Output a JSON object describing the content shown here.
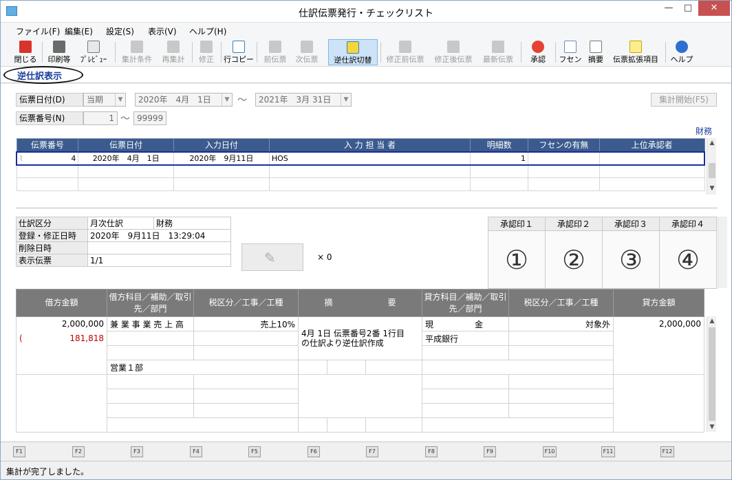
{
  "window": {
    "title": "仕訳伝票発行・チェックリスト",
    "minimize": "—",
    "maximize": "□",
    "close": "✕"
  },
  "menu": [
    "ファイル(F)",
    "編集(E)",
    "設定(S)",
    "表示(V)",
    "ヘルプ(H)"
  ],
  "toolbar": {
    "close": "閉じる",
    "print": "印刷等",
    "preview": "ﾌﾟﾚﾋﾞｭｰ",
    "agg_cond": "集計条件",
    "reagg": "再集計",
    "edit": "修正",
    "row_copy": "行コピー",
    "prev_slip": "前伝票",
    "next_slip": "次伝票",
    "reverse_switch": "逆仕訳切替",
    "before_edit": "修正前伝票",
    "after_edit": "修正後伝票",
    "latest": "最新伝票",
    "approve": "承認",
    "fusen": "フセン",
    "summary": "摘要",
    "ext_items": "伝票拡張項目",
    "help": "ヘルプ"
  },
  "tab": {
    "label": "逆仕訳表示"
  },
  "filters": {
    "date_label": "伝票日付(D)",
    "period": "当期",
    "date_from": "2020年　4月　1日",
    "date_to": "2021年　3月 31日",
    "number_label": "伝票番号(N)",
    "num_from": "1",
    "num_to": "99999",
    "tilde": "～",
    "start_button": "集計開始(F5)"
  },
  "dept_link": "財務",
  "list": {
    "headers": [
      "伝票番号",
      "伝票日付",
      "入力日付",
      "入 力 担 当 者",
      "明細数",
      "フセンの有無",
      "上位承認者"
    ],
    "row": {
      "number": "4",
      "date": "2020年　4月　1日",
      "input_date": "2020年　9月11日",
      "person": "HOS",
      "count": "1",
      "fusen": "",
      "approver": ""
    }
  },
  "info": {
    "kubun_label": "仕訳区分",
    "kubun": "月次仕訳",
    "dept": "財務",
    "reg_label": "登録・修正日時",
    "reg": "2020年　9月11日　13:29:04",
    "del_label": "削除日時",
    "del": "",
    "disp_label": "表示伝票",
    "disp": "1/1"
  },
  "attach_count": "× 0",
  "stamps": {
    "headers": [
      "承認印１",
      "承認印２",
      "承認印３",
      "承認印４"
    ],
    "marks": [
      "①",
      "②",
      "③",
      "④"
    ]
  },
  "journal": {
    "h_debit_amount": "借方金額",
    "h_debit_acct": "借方科目／補助／取引先／部門",
    "h_tax": "税区分／工事／工種",
    "h_memo1": "摘",
    "h_memo2": "要",
    "h_credit_acct": "貸方科目／補助／取引先／部門",
    "h_credit_amount": "貸方金額",
    "debit_amount": "2,000,000",
    "debit_tax_paren": "(",
    "debit_tax": "181,818",
    "debit_acct": "兼 業 事 業 売 上 高",
    "debit_tax_class": "売上10%",
    "debit_dept": "営業１部",
    "memo": "4月 1日 伝票番号2番 1行目 の仕訳より逆仕訳作成",
    "credit_acct": "現　　　　　金",
    "credit_sub": "平成銀行",
    "credit_tax_class": "対象外",
    "credit_amount": "2,000,000"
  },
  "fkeys": [
    "F1",
    "F2",
    "F3",
    "F4",
    "F5",
    "F6",
    "F7",
    "F8",
    "F9",
    "F10",
    "F11",
    "F12"
  ],
  "status": "集計が完了しました。"
}
